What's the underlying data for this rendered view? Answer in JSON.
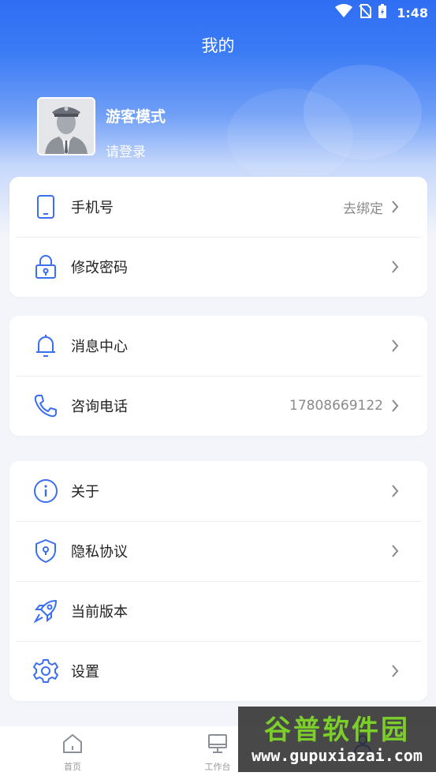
{
  "status_bar": {
    "time": "1:48"
  },
  "header": {
    "title": "我的"
  },
  "profile": {
    "name": "游客模式",
    "login_hint": "请登录"
  },
  "groups": [
    {
      "items": [
        {
          "label": "手机号",
          "value": "去绑定",
          "icon": "phone-icon",
          "chevron": true
        },
        {
          "label": "修改密码",
          "value": "",
          "icon": "lock-icon",
          "chevron": true
        }
      ]
    },
    {
      "items": [
        {
          "label": "消息中心",
          "value": "",
          "icon": "bell-icon",
          "chevron": true
        },
        {
          "label": "咨询电话",
          "value": "17808669122",
          "icon": "telephone-icon",
          "chevron": true
        }
      ]
    },
    {
      "items": [
        {
          "label": "关于",
          "value": "",
          "icon": "info-icon",
          "chevron": true
        },
        {
          "label": "隐私协议",
          "value": "",
          "icon": "shield-icon",
          "chevron": true
        },
        {
          "label": "当前版本",
          "value": "",
          "icon": "rocket-icon",
          "chevron": false
        },
        {
          "label": "设置",
          "value": "",
          "icon": "gear-icon",
          "chevron": true
        }
      ]
    }
  ],
  "tabbar": {
    "tabs": [
      {
        "label": "首页",
        "icon": "home-icon"
      },
      {
        "label": "工作台",
        "icon": "desktop-icon"
      },
      {
        "label": "",
        "icon": "profile-icon"
      }
    ]
  },
  "watermark": {
    "title": "谷普软件园",
    "url": "www.gupuxiazai.com"
  },
  "colors": {
    "accent": "#3a6ff3",
    "header_top": "#2f6ef3",
    "background": "#f3f5fa"
  }
}
